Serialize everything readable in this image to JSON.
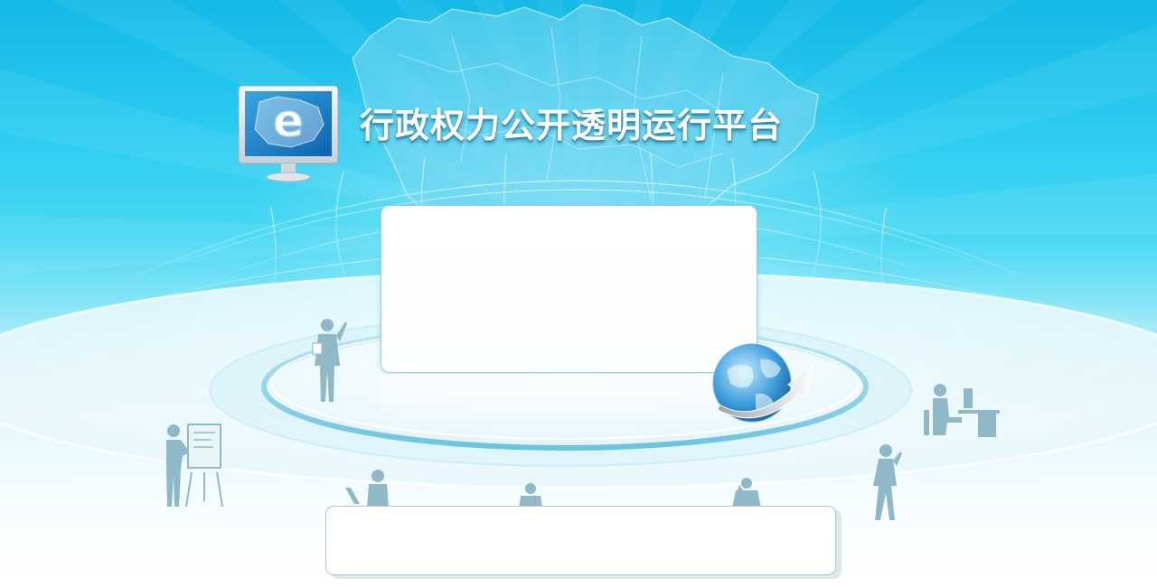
{
  "header": {
    "title": "行政权力公开透明运行平台"
  },
  "logo": {
    "icon": "monitor-e-icon",
    "letter": "e"
  },
  "login_panel": {
    "content": ""
  },
  "footer": {
    "content": ""
  },
  "colors": {
    "sky_top": "#14b9e6",
    "sky_mid": "#48d8f3",
    "platform_edge": "#7fcde6",
    "panel_border": "#9dcfe2",
    "footer_border": "#b8c3c8",
    "silhouette": "#8fb9c6"
  }
}
